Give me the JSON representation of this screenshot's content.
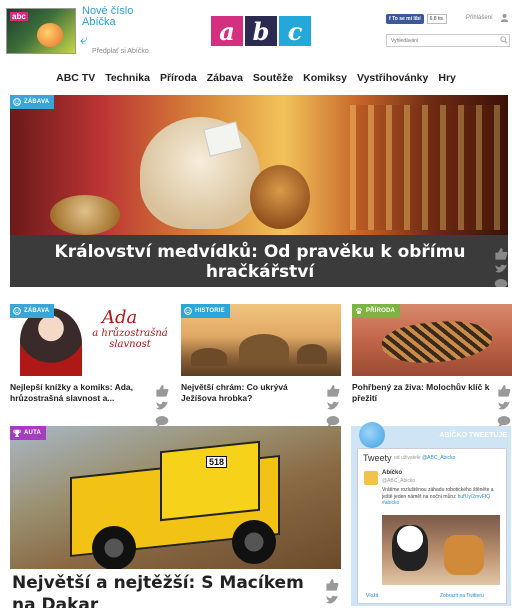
{
  "header": {
    "promo": {
      "title": "Nové číslo Abíčka",
      "subtitle": "Předplať si Abíčko",
      "mini_logo": "abc"
    },
    "logo": [
      "a",
      "b",
      "c"
    ],
    "logo_colors": [
      "#d5307f",
      "#2b2b52",
      "#23a8d9"
    ],
    "facebook": {
      "button": "To se mi líbí",
      "count": "6,8 tis."
    },
    "login_label": "Přihlášení",
    "search_placeholder": "Vyhledávání"
  },
  "nav": [
    "ABC TV",
    "Technika",
    "Příroda",
    "Zábava",
    "Soutěže",
    "Komiksy",
    "Vystřihovánky",
    "Hry"
  ],
  "hero": {
    "category": "ZÁBAVA",
    "category_color": "#3aa5d9",
    "title": "Království medvídků: Od pravěku k obřímu hračkářství"
  },
  "cards": [
    {
      "category": "ZÁBAVA",
      "category_color": "#3aa5d9",
      "image_title": "Ada",
      "image_subtitle": "a hrůzostrašná slavnost",
      "title": "Nejlepší knížky a komiks: Ada, hrůzostrašná slavnost a..."
    },
    {
      "category": "HISTORIE",
      "category_color": "#2aa7d8",
      "title": "Největší chrám: Co ukrývá Ježíšova hrobka?"
    },
    {
      "category": "PŘÍRODA",
      "category_color": "#7cb342",
      "title": "Pohřbený za živa: Molochův klíč k přežití"
    }
  ],
  "bottom": {
    "category": "AUTA",
    "category_color": "#a63cbf",
    "truck_number": "518",
    "title": "Největší a nejtěžší: S Macíkem na Dakar"
  },
  "twitter": {
    "header": "ABÍČKO TWEETUJE",
    "title": "Tweety",
    "by": "od uživatele",
    "by_handle": "@ABC_Abicko",
    "name": "Abíčko",
    "handle": "@ABC_Abicko",
    "text": "Vrátíme rozluštěnou záhadu robotického štěněte a ještě jeden námět na noční můru:",
    "text_link": "buff.ly/2mvFfQ #abicko",
    "footer_left": "Vložit",
    "footer_right": "Zobrazit na Twitteru"
  }
}
